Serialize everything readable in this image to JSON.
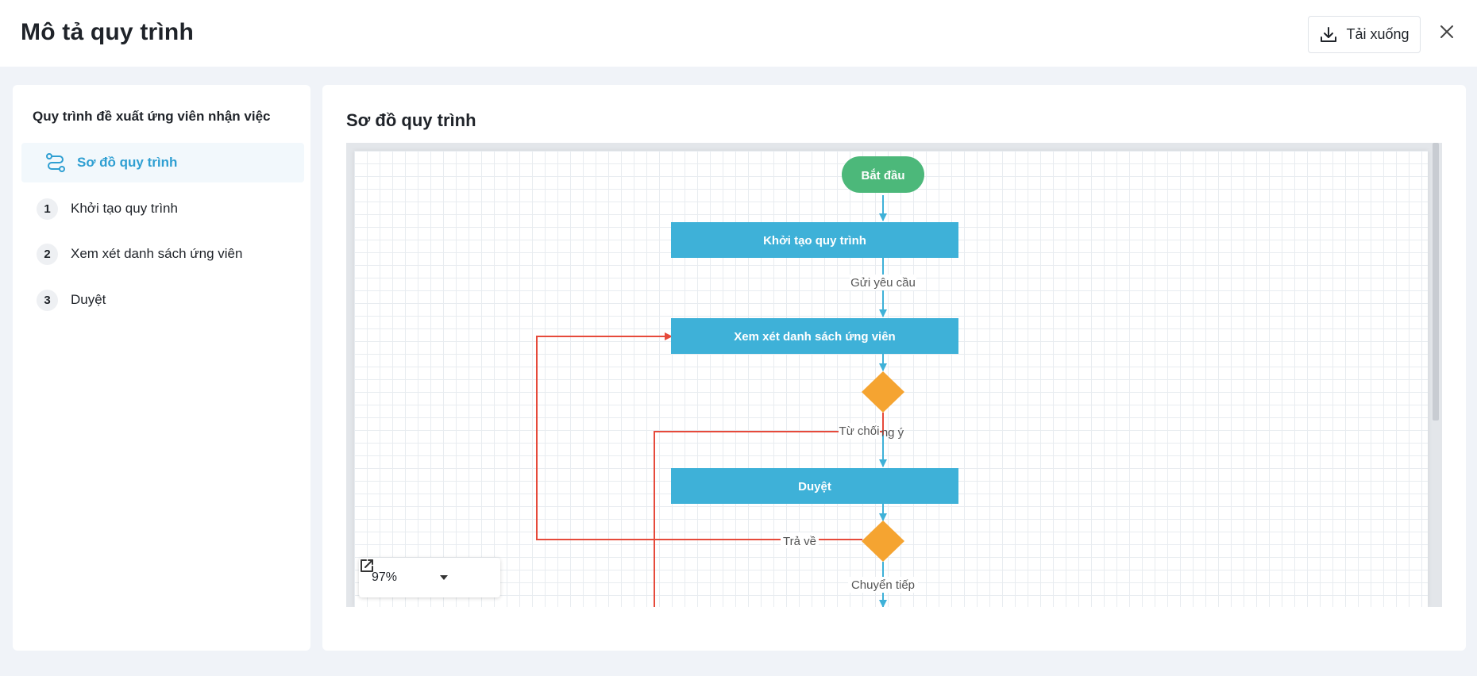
{
  "header": {
    "title": "Mô tả quy trình",
    "download_label": "Tải xuống"
  },
  "sidebar": {
    "heading": "Quy trình đề xuất ứng viên nhận việc",
    "items": [
      {
        "label": "Sơ đồ quy trình",
        "icon": "flow-icon",
        "active": true
      },
      {
        "number": "1",
        "label": "Khởi tạo quy trình"
      },
      {
        "number": "2",
        "label": "Xem xét danh sách ứng viên"
      },
      {
        "number": "3",
        "label": "Duyệt"
      }
    ]
  },
  "main": {
    "title": "Sơ đồ quy trình"
  },
  "diagram": {
    "nodes": {
      "start": "Bắt đầu",
      "step1": "Khởi tạo quy trình",
      "step2": "Xem xét danh sách ứng viên",
      "step3": "Duyệt"
    },
    "edges": {
      "send_request": "Gửi yêu cầu",
      "reject": "Từ chối",
      "agree_partial": "ng ý",
      "return": "Trả về",
      "forward": "Chuyển tiếp"
    },
    "colors": {
      "start": "#4cb87a",
      "process": "#3eb1d8",
      "decision": "#f5a431",
      "flow": "#3eb1d8",
      "back_flow": "#e64a3b"
    }
  },
  "zoom": {
    "value": "97%"
  }
}
